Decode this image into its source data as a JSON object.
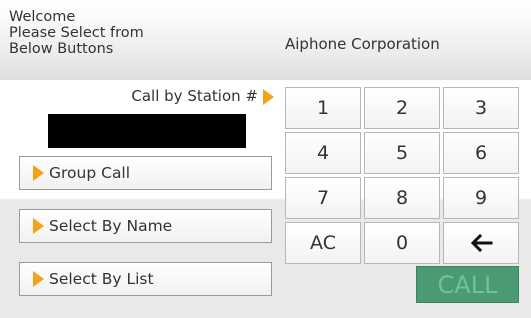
{
  "header": {
    "welcome_lines": [
      "Welcome",
      "Please Select from",
      "Below Buttons"
    ],
    "company": "Aiphone Corporation"
  },
  "station": {
    "label": "Call by Station #",
    "value": ""
  },
  "buttons": {
    "group_call": "Group Call",
    "select_by_name": "Select By Name",
    "select_by_list": "Select By List"
  },
  "keypad": {
    "keys": [
      "1",
      "2",
      "3",
      "4",
      "5",
      "6",
      "7",
      "8",
      "9",
      "AC",
      "0"
    ],
    "backspace_icon": "left-arrow-icon",
    "call_label": "CALL"
  },
  "colors": {
    "accent_arrow": "#f4a21a",
    "call_button": "#4a9a72",
    "call_text": "#6fc29a",
    "display": "#000000"
  }
}
